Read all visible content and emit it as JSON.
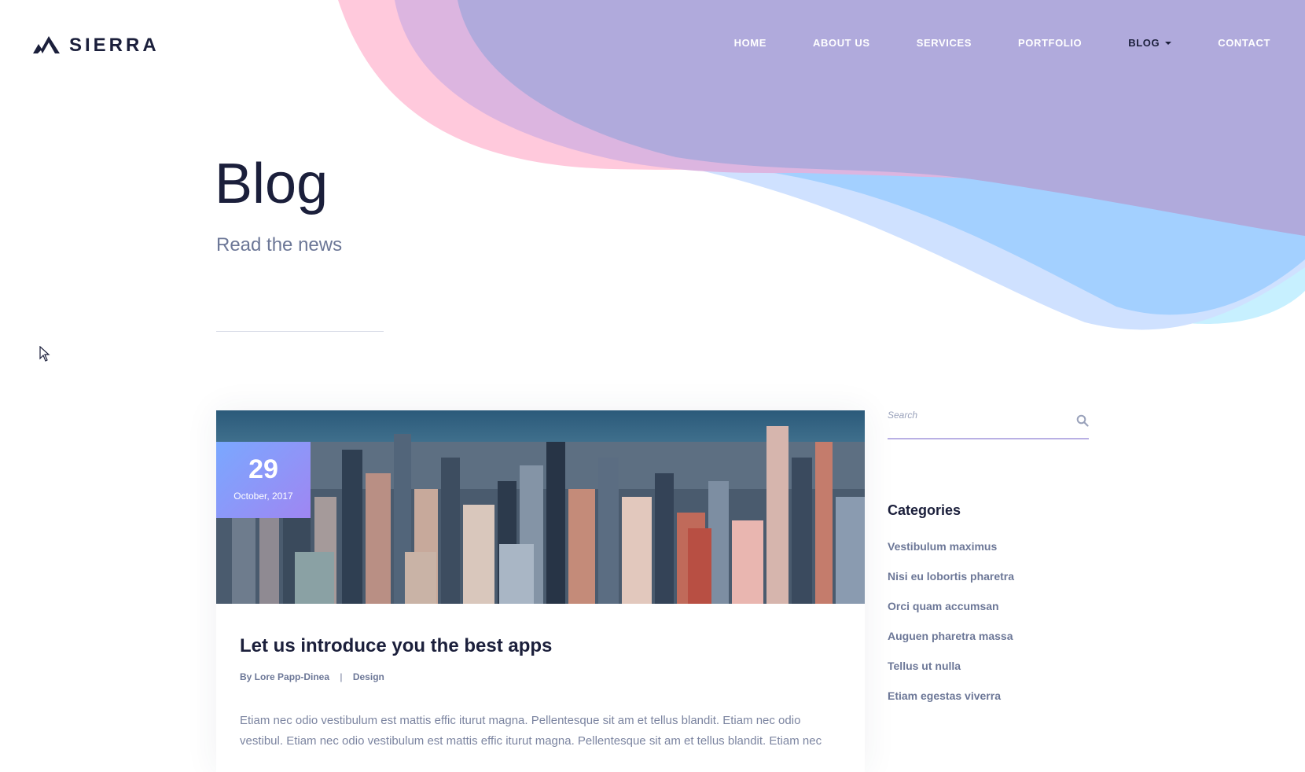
{
  "brand": {
    "name": "SIERRA",
    "icon": "mountain-logo-icon"
  },
  "nav": {
    "items": [
      {
        "label": "HOME"
      },
      {
        "label": "ABOUT US"
      },
      {
        "label": "SERVICES"
      },
      {
        "label": "PORTFOLIO"
      },
      {
        "label": "BLOG",
        "active": true,
        "has_dropdown": true
      },
      {
        "label": "CONTACT"
      }
    ]
  },
  "hero": {
    "title": "Blog",
    "subtitle": "Read the news"
  },
  "post": {
    "date_day": "29",
    "date_month": "October, 2017",
    "title": "Let us introduce you the best apps",
    "author": "By Lore Papp-Dinea",
    "separator": "|",
    "category": "Design",
    "excerpt": "Etiam nec odio vestibulum est mattis effic iturut magna. Pellentesque sit am et tellus blandit. Etiam nec odio vestibul. Etiam nec odio vestibulum est mattis effic iturut magna. Pellentesque sit am et tellus blandit. Etiam nec"
  },
  "sidebar": {
    "search": {
      "placeholder": "Search",
      "icon": "search-icon"
    },
    "categories": {
      "heading": "Categories",
      "items": [
        "Vestibulum maximus",
        "Nisi eu lobortis pharetra",
        "Orci quam accumsan",
        "Auguen pharetra massa",
        "Tellus ut nulla",
        "Etiam egestas viverra"
      ]
    }
  },
  "colors": {
    "text_dark": "#1b1f3b",
    "text_muted": "#6c7797",
    "wave_pink": "#ffc9dc",
    "wave_lilac": "#dcb5e0",
    "wave_purple": "#b0aadc",
    "wave_blue": "#a3d0ff",
    "badge_gradient_start": "#7aa8ff",
    "badge_gradient_end": "#9f86f2"
  }
}
